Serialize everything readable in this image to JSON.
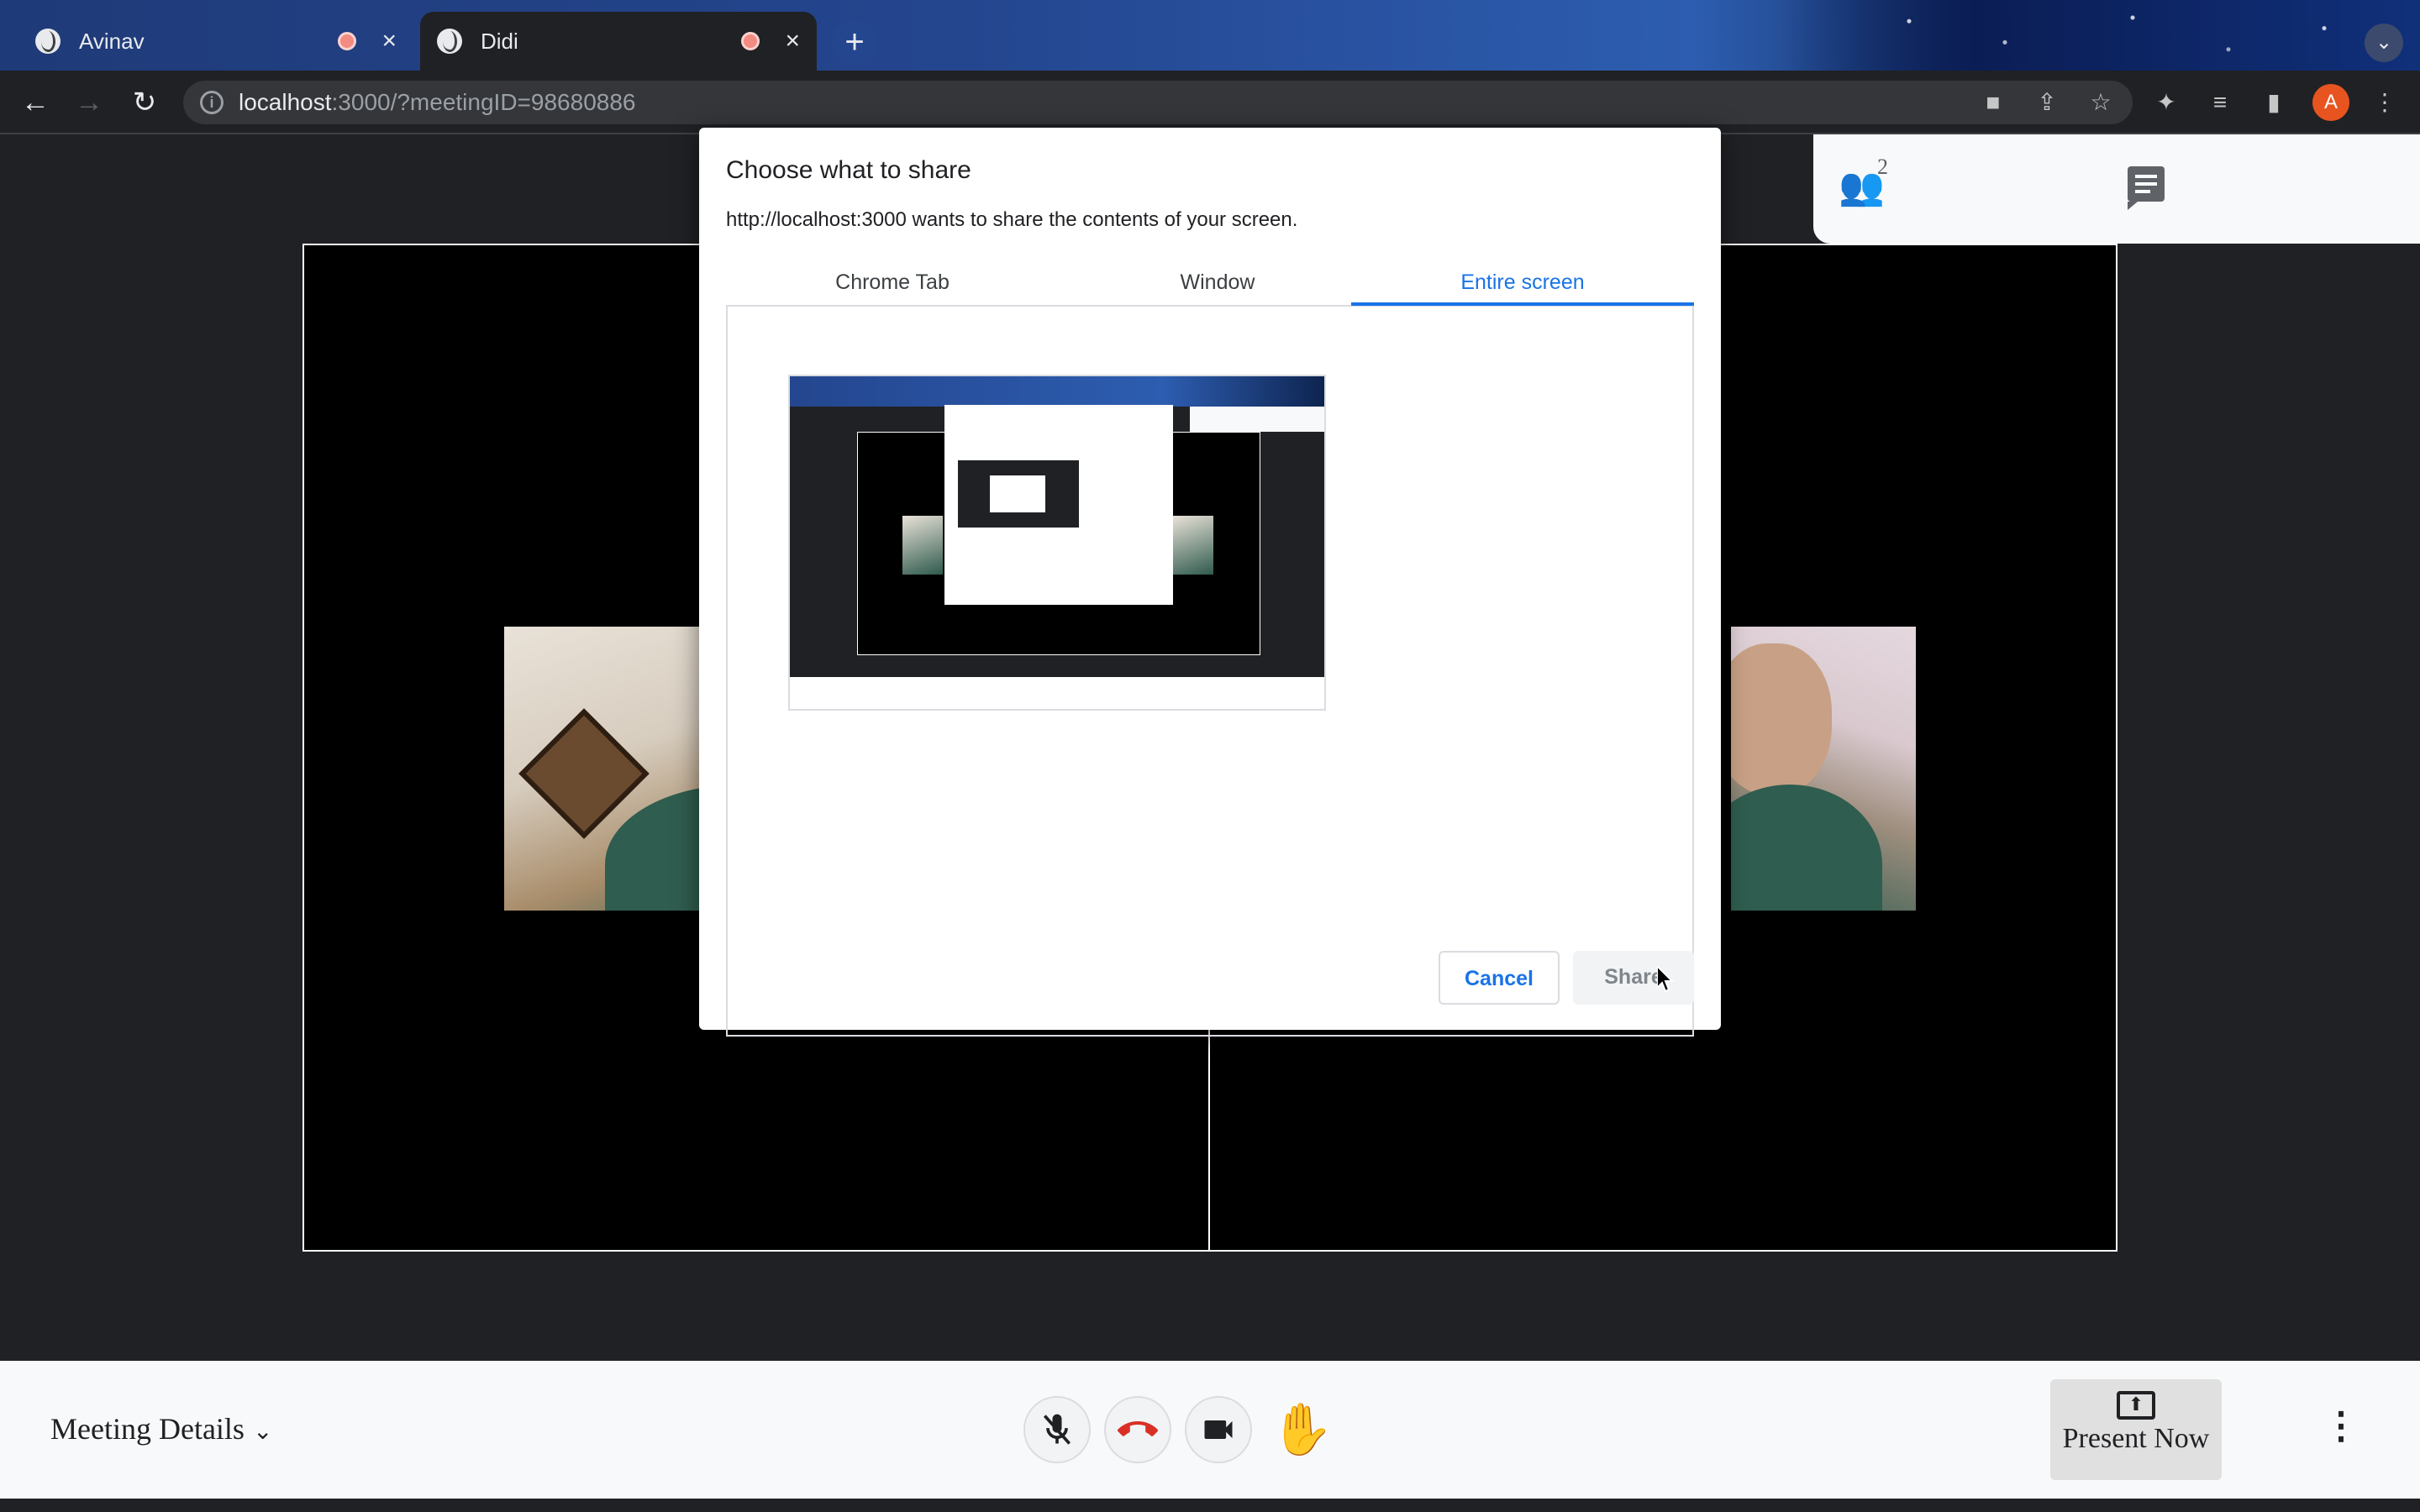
{
  "browser": {
    "tabs": [
      {
        "title": "Avinav"
      },
      {
        "title": "Didi"
      }
    ],
    "url_host": "localhost",
    "url_rest": ":3000/?meetingID=98680886",
    "profile_initial": "A"
  },
  "side_panel": {
    "participant_count": "2"
  },
  "dialog": {
    "title": "Choose what to share",
    "subtitle": "http://localhost:3000 wants to share the contents of your screen.",
    "tabs": [
      "Chrome Tab",
      "Window",
      "Entire screen"
    ],
    "selected_tab": "Entire screen",
    "cancel_label": "Cancel",
    "share_label": "Share"
  },
  "bottom_bar": {
    "meeting_details_label": "Meeting Details",
    "present_label": "Present Now"
  },
  "colors": {
    "accent": "#1a73e8",
    "end_call": "#d93025",
    "page_bg": "#202124"
  },
  "icons": [
    "globe-icon",
    "record-icon",
    "close-icon",
    "plus-icon",
    "back-icon",
    "forward-icon",
    "reload-icon",
    "info-icon",
    "camera-icon",
    "share-icon",
    "star-icon",
    "extensions-icon",
    "media-icon",
    "sidepanel-icon",
    "more-icon",
    "people-icon",
    "chat-icon",
    "mic-off-icon",
    "end-call-icon",
    "video-icon",
    "hand-icon",
    "present-icon"
  ]
}
